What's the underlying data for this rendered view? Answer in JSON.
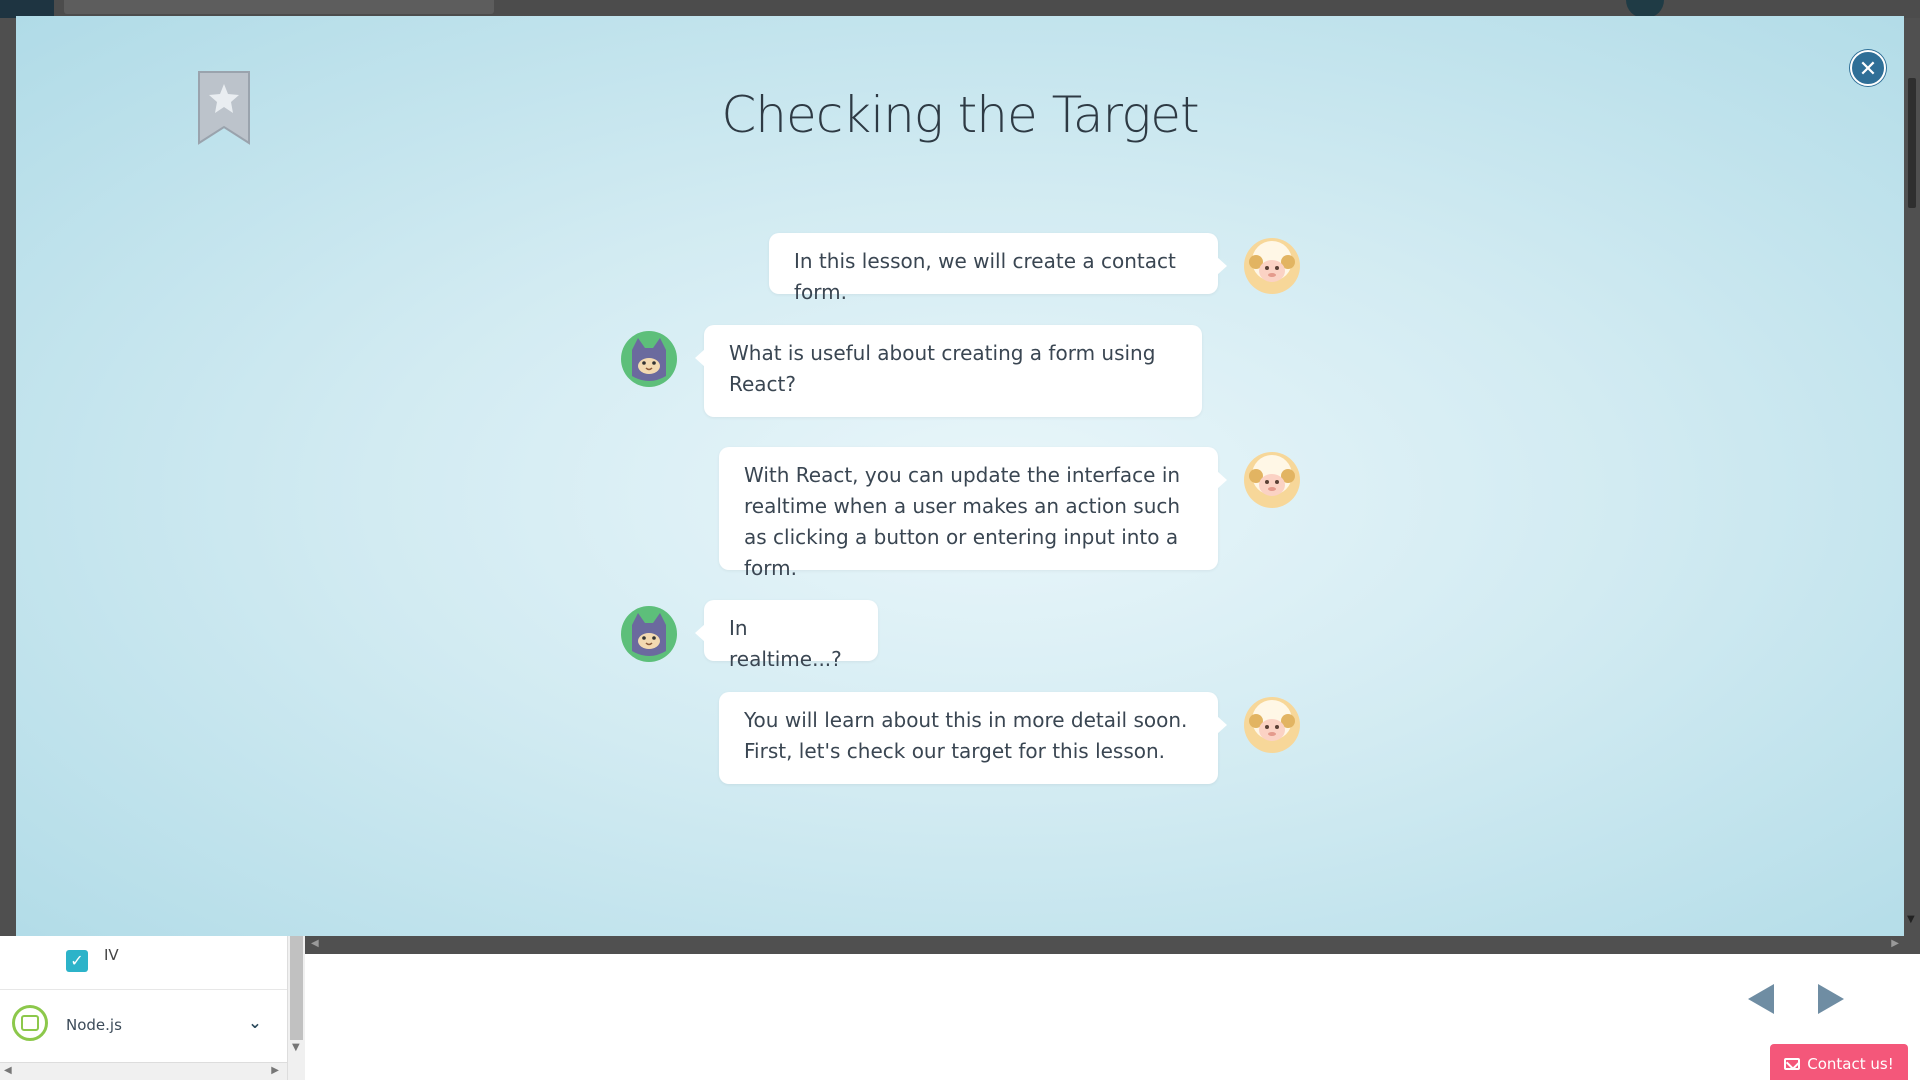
{
  "modal": {
    "title": "Checking the Target",
    "close_icon": "close-icon",
    "bookmark_icon": "bookmark-star-icon",
    "messages": [
      {
        "speaker": "sheep",
        "side": "right",
        "text": "In this lesson, we will create a contact form."
      },
      {
        "speaker": "ninja",
        "side": "left",
        "text": "What is useful about creating a form using React?"
      },
      {
        "speaker": "sheep",
        "side": "right",
        "text": "With React, you can update the interface in realtime when a user makes an action such as clicking a button or entering input into a form."
      },
      {
        "speaker": "ninja",
        "side": "left",
        "text": "In realtime...?"
      },
      {
        "speaker": "sheep",
        "side": "right",
        "text": "You will learn about this in more detail soon. First, let's check our target for this lesson."
      }
    ]
  },
  "sidebar": {
    "checked_item_label": "IV",
    "course_label": "Node.js"
  },
  "footer": {
    "prev_icon": "prev-arrow-icon",
    "next_icon": "next-arrow-icon",
    "contact_label": "Contact us!"
  },
  "colors": {
    "accent_pink": "#f4577a",
    "close_blue": "#2f6f97",
    "checkbox_teal": "#2cb3c9",
    "node_green": "#8cc84b"
  }
}
